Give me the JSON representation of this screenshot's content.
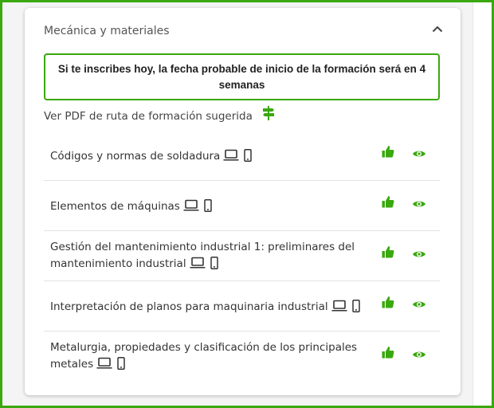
{
  "section": {
    "title": "Mecánica y materiales",
    "collapse_icon": "chevron-up-icon"
  },
  "notice": {
    "text": "Si te inscribes hoy, la fecha probable de inicio de la formación será en 4 semanas"
  },
  "pdf": {
    "label": "Ver PDF de ruta de formación sugerida",
    "icon": "signpost-icon"
  },
  "courses": [
    {
      "name": "Códigos y normas de soldadura"
    },
    {
      "name": "Elementos de máquinas"
    },
    {
      "name": "Gestión del mantenimiento industrial 1: preliminares del mantenimiento industrial"
    },
    {
      "name": "Interpretación de planos para maquinaria industrial"
    },
    {
      "name": "Metalurgia, propiedades y clasificación de los principales metales"
    }
  ],
  "colors": {
    "accent": "#3aa80f",
    "icon_green": "#3aa80f",
    "text": "#333333"
  }
}
